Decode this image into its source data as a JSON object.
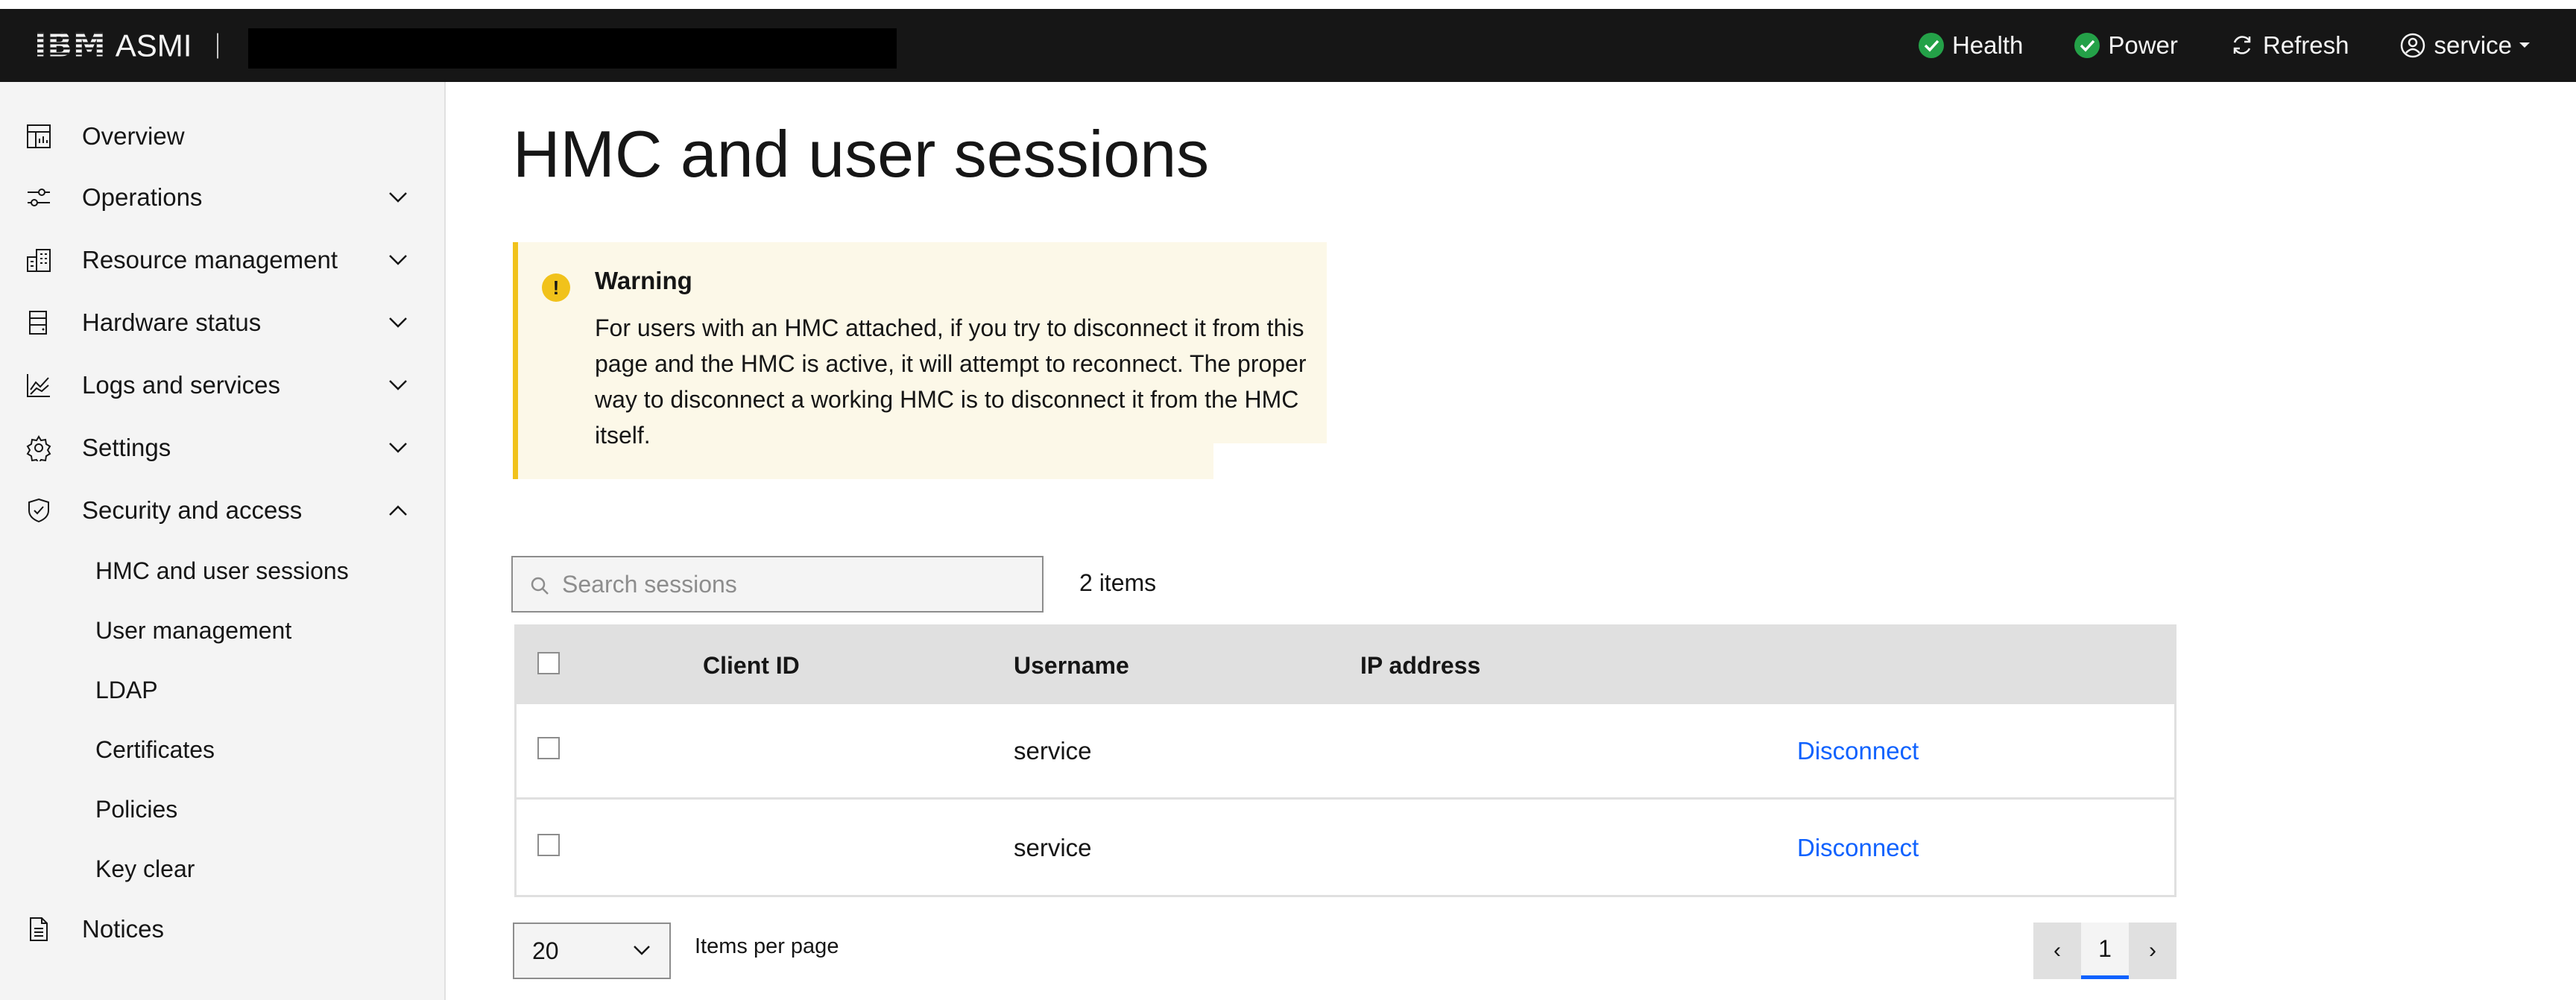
{
  "header": {
    "brand": "IBM",
    "app_name": "ASMI",
    "actions": {
      "health": "Health",
      "power": "Power",
      "refresh": "Refresh",
      "user": "service"
    },
    "status_color": "#24a148"
  },
  "sidebar": {
    "items": [
      {
        "label": "Overview",
        "icon": "dashboard-icon"
      },
      {
        "label": "Operations",
        "icon": "sliders-icon"
      },
      {
        "label": "Resource management",
        "icon": "building-icon"
      },
      {
        "label": "Hardware status",
        "icon": "server-icon"
      },
      {
        "label": "Logs and services",
        "icon": "chart-icon"
      },
      {
        "label": "Settings",
        "icon": "gear-icon"
      },
      {
        "label": "Security and access",
        "icon": "shield-icon"
      },
      {
        "label": "Notices",
        "icon": "document-icon"
      }
    ],
    "security_subitems": [
      "HMC and user sessions",
      "User management",
      "LDAP",
      "Certificates",
      "Policies",
      "Key clear"
    ]
  },
  "main": {
    "title": "HMC and user sessions",
    "warning": {
      "title": "Warning",
      "text": "For users with an HMC attached, if you try to disconnect it from this page and the HMC is active, it will attempt to reconnect. The proper way to disconnect a working HMC is to disconnect it from the HMC itself.",
      "color": "#f1c21b"
    },
    "search": {
      "placeholder": "Search sessions",
      "value": ""
    },
    "items_count": "2 items",
    "table": {
      "columns": [
        "Client ID",
        "Username",
        "IP address"
      ],
      "rows": [
        {
          "client_id": "",
          "username": "service",
          "ip": "",
          "action": "Disconnect"
        },
        {
          "client_id": "",
          "username": "service",
          "ip": "",
          "action": "Disconnect"
        }
      ]
    },
    "pagination": {
      "per_page": "20",
      "per_page_label": "Items per page",
      "current_page": "1",
      "prev": "‹",
      "next": "›"
    },
    "link_color": "#0f62fe"
  }
}
